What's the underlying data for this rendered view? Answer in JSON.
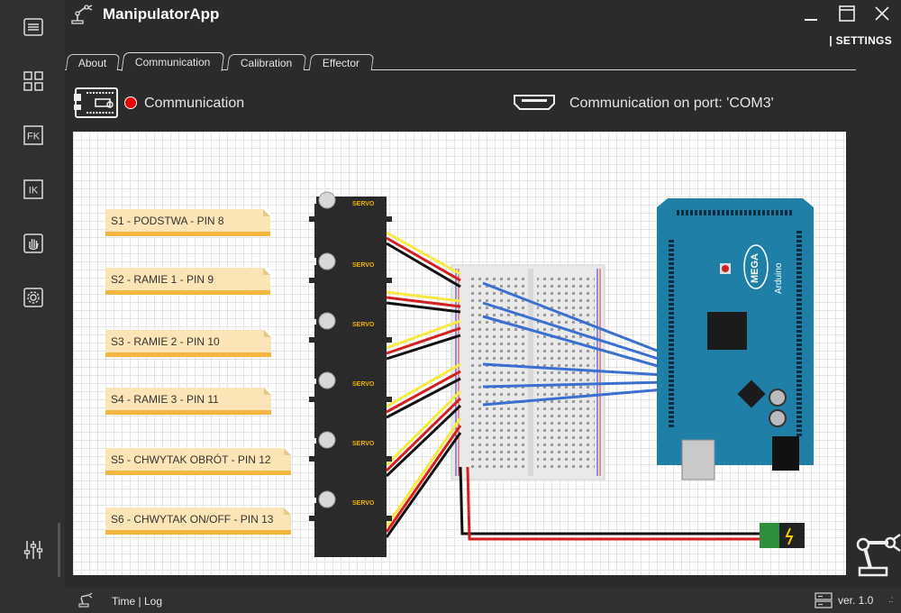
{
  "app": {
    "title": "ManipulatorApp"
  },
  "header": {
    "settings_label": "| SETTINGS"
  },
  "sidebar": {
    "items": [
      {
        "icon": "menu-icon"
      },
      {
        "icon": "dashboard-icon"
      },
      {
        "icon": "fk-icon",
        "label": "FK"
      },
      {
        "icon": "ik-icon",
        "label": "IK"
      },
      {
        "icon": "hand-icon"
      },
      {
        "icon": "gear-icon"
      },
      {
        "icon": "sliders-icon"
      }
    ]
  },
  "tabs": [
    {
      "label": "About",
      "active": false
    },
    {
      "label": "Communication",
      "active": true
    },
    {
      "label": "Calibration",
      "active": false
    },
    {
      "label": "Effector",
      "active": false
    }
  ],
  "status": {
    "label": "Communication",
    "indicator_color": "#ee0000",
    "port_text": "Communication on port: 'COM3'"
  },
  "diagram": {
    "servo_notes": [
      "S1 - PODSTWA - PIN 8",
      "S2 - RAMIE 1 - PIN 9",
      "S3 - RAMIE 2 - PIN 10",
      "S4 - RAMIE 3 - PIN 11",
      "S5 - CHWYTAK OBRÓT - PIN 12",
      "S6 - CHWYTAK ON/OFF - PIN 13"
    ],
    "servo_label": "SERVO",
    "board_label": "MEGA",
    "board_sub_label": "Arduino"
  },
  "footer": {
    "time_log": "Time | Log",
    "version": "ver. 1.0"
  },
  "colors": {
    "background": "#2b2b2b",
    "arduino_blue": "#1f7fa6",
    "note_fill": "#fbe5b6",
    "note_border": "#f5b640"
  }
}
